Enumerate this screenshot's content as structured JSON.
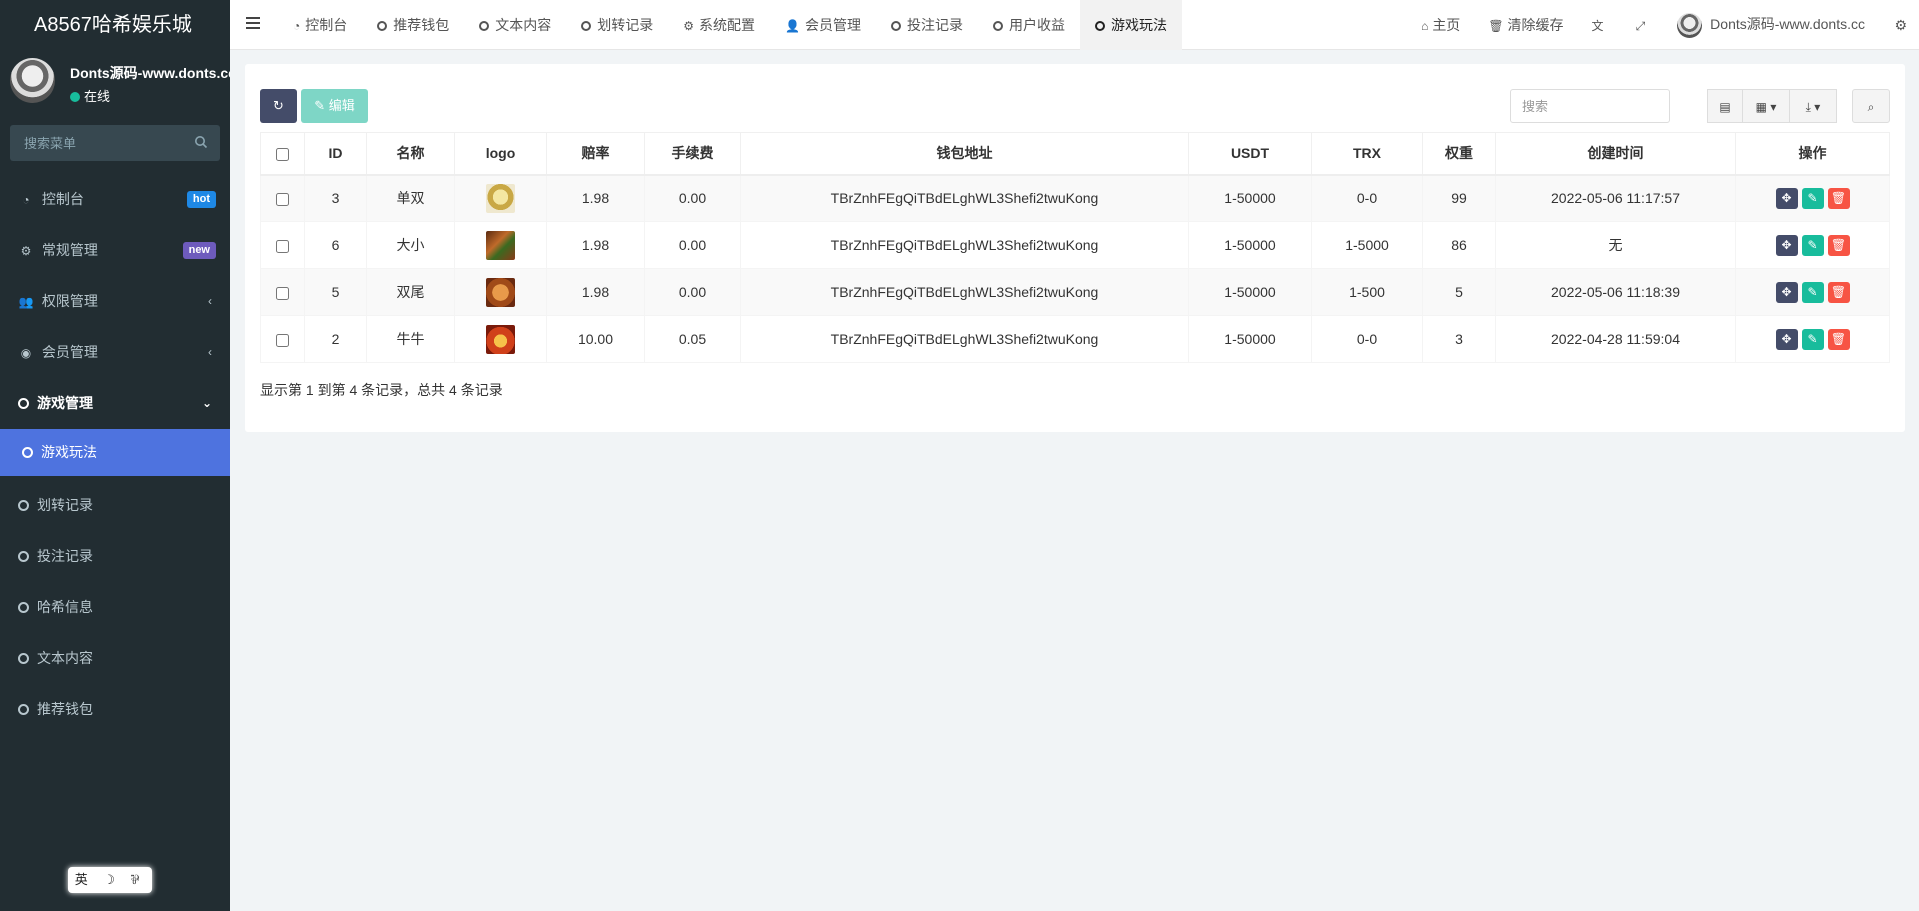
{
  "app": {
    "title": "A8567哈希娱乐城"
  },
  "user": {
    "name": "Donts源码-www.donts.cc",
    "status": "在线"
  },
  "sidebar": {
    "search_placeholder": "搜索菜单",
    "items": [
      {
        "label": "控制台",
        "icon": "dashboard-icon",
        "badge": "hot",
        "badge_color": "#1e88e5"
      },
      {
        "label": "常规管理",
        "icon": "cogs-icon",
        "badge": "new",
        "badge_color": "#6e5bbd"
      },
      {
        "label": "权限管理",
        "icon": "group-icon"
      },
      {
        "label": "会员管理",
        "icon": "user-circle-icon"
      },
      {
        "label": "游戏管理",
        "icon": "circle-icon"
      }
    ],
    "sub_items": [
      {
        "label": "游戏玩法"
      },
      {
        "label": "划转记录"
      },
      {
        "label": "投注记录"
      },
      {
        "label": "哈希信息"
      },
      {
        "label": "文本内容"
      },
      {
        "label": "推荐钱包"
      }
    ],
    "lang_widget": "英 ☽ ⅌"
  },
  "topbar": {
    "tabs": [
      {
        "label": "控制台",
        "icon": "dashboard-icon"
      },
      {
        "label": "推荐钱包",
        "icon": "circle-icon"
      },
      {
        "label": "文本内容",
        "icon": "circle-icon"
      },
      {
        "label": "划转记录",
        "icon": "circle-icon"
      },
      {
        "label": "系统配置",
        "icon": "gear-icon"
      },
      {
        "label": "会员管理",
        "icon": "user-icon"
      },
      {
        "label": "投注记录",
        "icon": "circle-icon"
      },
      {
        "label": "用户收益",
        "icon": "circle-icon"
      },
      {
        "label": "游戏玩法",
        "icon": "circle-icon"
      }
    ],
    "home_label": "主页",
    "clear_cache_label": "清除缓存",
    "user_label": "Donts源码-www.donts.cc"
  },
  "toolbar": {
    "edit_label": "编辑",
    "search_placeholder": "搜索"
  },
  "table": {
    "headers": [
      "ID",
      "名称",
      "logo",
      "赔率",
      "手续费",
      "钱包地址",
      "USDT",
      "TRX",
      "权重",
      "创建时间",
      "操作"
    ],
    "rows": [
      {
        "id": "3",
        "name": "单双",
        "logo_color": "#d8c56a",
        "odds": "1.98",
        "fee": "0.00",
        "wallet": "TBrZnhFEgQiTBdELghWL3Shefi2twuKong",
        "usdt": "1-50000",
        "trx": "0-0",
        "weight": "99",
        "created": "2022-05-06 11:17:57"
      },
      {
        "id": "6",
        "name": "大小",
        "logo_color": "#8a4a2a",
        "odds": "1.98",
        "fee": "0.00",
        "wallet": "TBrZnhFEgQiTBdELghWL3Shefi2twuKong",
        "usdt": "1-50000",
        "trx": "1-5000",
        "weight": "86",
        "created": "无"
      },
      {
        "id": "5",
        "name": "双尾",
        "logo_color": "#b0602a",
        "odds": "1.98",
        "fee": "0.00",
        "wallet": "TBrZnhFEgQiTBdELghWL3Shefi2twuKong",
        "usdt": "1-50000",
        "trx": "1-500",
        "weight": "5",
        "created": "2022-05-06 11:18:39"
      },
      {
        "id": "2",
        "name": "牛牛",
        "logo_color": "#c8401c",
        "odds": "10.00",
        "fee": "0.05",
        "wallet": "TBrZnhFEgQiTBdELghWL3Shefi2twuKong",
        "usdt": "1-50000",
        "trx": "0-0",
        "weight": "3",
        "created": "2022-04-28 11:59:04"
      }
    ]
  },
  "pager": {
    "summary": "显示第 1 到第 4 条记录，总共 4 条记录"
  }
}
